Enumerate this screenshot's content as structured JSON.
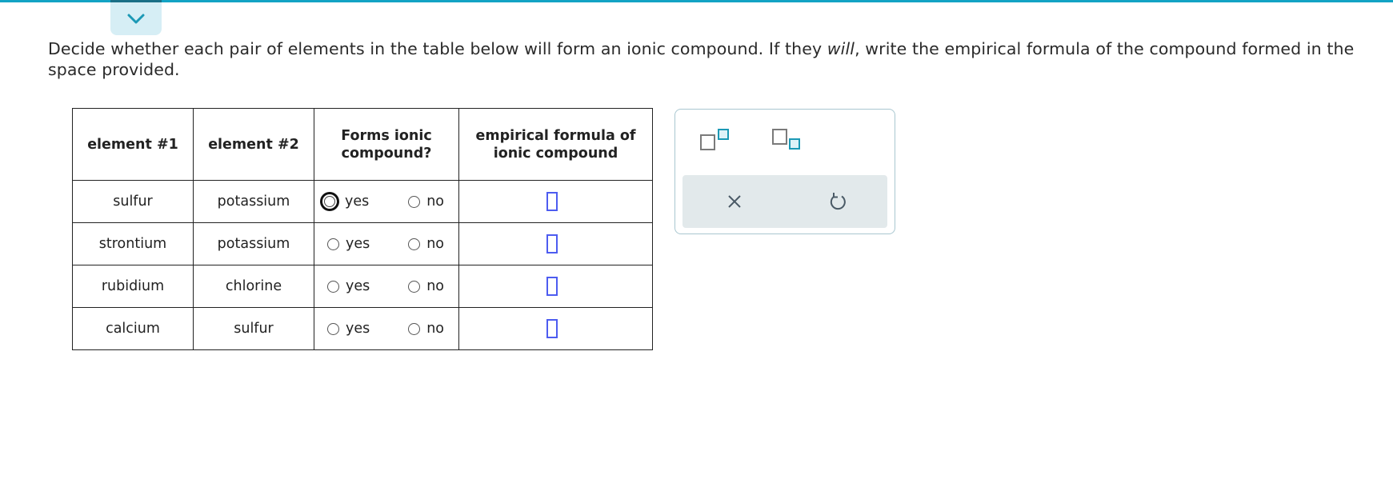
{
  "prompt": {
    "part1": "Decide whether each pair of elements in the table below will form an ionic compound. If they ",
    "emphasis": "will",
    "part2": ", write the empirical formula of the compound formed in the space provided."
  },
  "table": {
    "headers": {
      "element1": "element #1",
      "element2": "element #2",
      "forms_ionic": "Forms ionic compound?",
      "formula": "empirical formula of ionic compound"
    },
    "option_yes": "yes",
    "option_no": "no",
    "rows": [
      {
        "element1": "sulfur",
        "element2": "potassium"
      },
      {
        "element1": "strontium",
        "element2": "potassium"
      },
      {
        "element1": "rubidium",
        "element2": "chlorine"
      },
      {
        "element1": "calcium",
        "element2": "sulfur"
      }
    ]
  },
  "toolbar": {
    "icons": [
      "superscript-icon",
      "subscript-icon",
      "clear-icon",
      "undo-icon"
    ]
  },
  "colors": {
    "accent": "#13a3c4",
    "input_border": "#4d5cf0",
    "tool_teal": "#1c99b5"
  }
}
